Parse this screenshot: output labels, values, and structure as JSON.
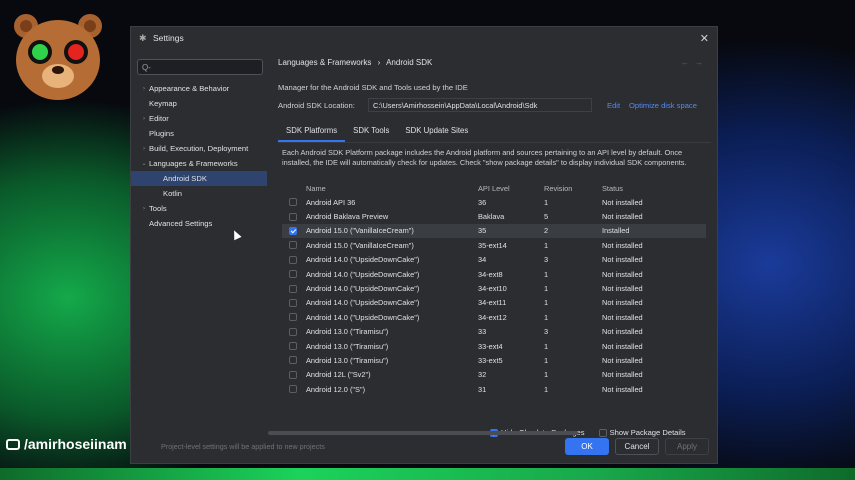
{
  "dialog": {
    "title": "Settings"
  },
  "search": {
    "placeholder": "Q-"
  },
  "tree": [
    {
      "label": "Appearance & Behavior",
      "arrow": "›",
      "indent": 0
    },
    {
      "label": "Keymap",
      "arrow": "",
      "indent": 0
    },
    {
      "label": "Editor",
      "arrow": "›",
      "indent": 0
    },
    {
      "label": "Plugins",
      "arrow": "",
      "indent": 0
    },
    {
      "label": "Build, Execution, Deployment",
      "arrow": "›",
      "indent": 0
    },
    {
      "label": "Languages & Frameworks",
      "arrow": "⌄",
      "indent": 0
    },
    {
      "label": "Android SDK",
      "arrow": "",
      "indent": 1,
      "selected": true
    },
    {
      "label": "Kotlin",
      "arrow": "",
      "indent": 1
    },
    {
      "label": "Tools",
      "arrow": "›",
      "indent": 0
    },
    {
      "label": "Advanced Settings",
      "arrow": "",
      "indent": 0
    }
  ],
  "breadcrumb": {
    "parent": "Languages & Frameworks",
    "sep": "›",
    "current": "Android SDK"
  },
  "description": "Manager for the Android SDK and Tools used by the IDE",
  "location": {
    "label": "Android SDK Location:",
    "value": "C:\\Users\\Amirhossein\\AppData\\Local\\Android\\Sdk",
    "edit": "Edit",
    "optimize": "Optimize disk space"
  },
  "tabs": [
    "SDK Platforms",
    "SDK Tools",
    "SDK Update Sites"
  ],
  "info": "Each Android SDK Platform package includes the Android platform and sources pertaining to an API level by default. Once installed, the IDE will automatically check for updates. Check \"show package details\" to display individual SDK components.",
  "table": {
    "columns": [
      "Name",
      "API Level",
      "Revision",
      "Status"
    ],
    "rows": [
      {
        "name": "Android API 36",
        "api": "36",
        "rev": "1",
        "status": "Not installed",
        "checked": false
      },
      {
        "name": "Android Baklava Preview",
        "api": "Baklava",
        "rev": "5",
        "status": "Not installed",
        "checked": false
      },
      {
        "name": "Android 15.0 (\"VanillaIceCream\")",
        "api": "35",
        "rev": "2",
        "status": "Installed",
        "checked": true
      },
      {
        "name": "Android 15.0 (\"VanillaIceCream\")",
        "api": "35-ext14",
        "rev": "1",
        "status": "Not installed",
        "checked": false
      },
      {
        "name": "Android 14.0 (\"UpsideDownCake\")",
        "api": "34",
        "rev": "3",
        "status": "Not installed",
        "checked": false
      },
      {
        "name": "Android 14.0 (\"UpsideDownCake\")",
        "api": "34-ext8",
        "rev": "1",
        "status": "Not installed",
        "checked": false
      },
      {
        "name": "Android 14.0 (\"UpsideDownCake\")",
        "api": "34-ext10",
        "rev": "1",
        "status": "Not installed",
        "checked": false
      },
      {
        "name": "Android 14.0 (\"UpsideDownCake\")",
        "api": "34-ext11",
        "rev": "1",
        "status": "Not installed",
        "checked": false
      },
      {
        "name": "Android 14.0 (\"UpsideDownCake\")",
        "api": "34-ext12",
        "rev": "1",
        "status": "Not installed",
        "checked": false
      },
      {
        "name": "Android 13.0 (\"Tiramisu\")",
        "api": "33",
        "rev": "3",
        "status": "Not installed",
        "checked": false
      },
      {
        "name": "Android 13.0 (\"Tiramisu\")",
        "api": "33-ext4",
        "rev": "1",
        "status": "Not installed",
        "checked": false
      },
      {
        "name": "Android 13.0 (\"Tiramisu\")",
        "api": "33-ext5",
        "rev": "1",
        "status": "Not installed",
        "checked": false
      },
      {
        "name": "Android 12L (\"Sv2\")",
        "api": "32",
        "rev": "1",
        "status": "Not installed",
        "checked": false
      },
      {
        "name": "Android 12.0 (\"S\")",
        "api": "31",
        "rev": "1",
        "status": "Not installed",
        "checked": false
      }
    ]
  },
  "options": {
    "hide_obsolete": {
      "label": "Hide Obsolete Packages",
      "checked": true
    },
    "show_details": {
      "label": "Show Package Details",
      "checked": false
    }
  },
  "footer": {
    "note": "Project-level settings will be applied to new projects",
    "ok": "OK",
    "cancel": "Cancel",
    "apply": "Apply"
  },
  "watermark": "/amirhoseiinam",
  "colors": {
    "accent": "#3574f0",
    "link": "#548af7",
    "selected_nav": "#2e436e"
  }
}
